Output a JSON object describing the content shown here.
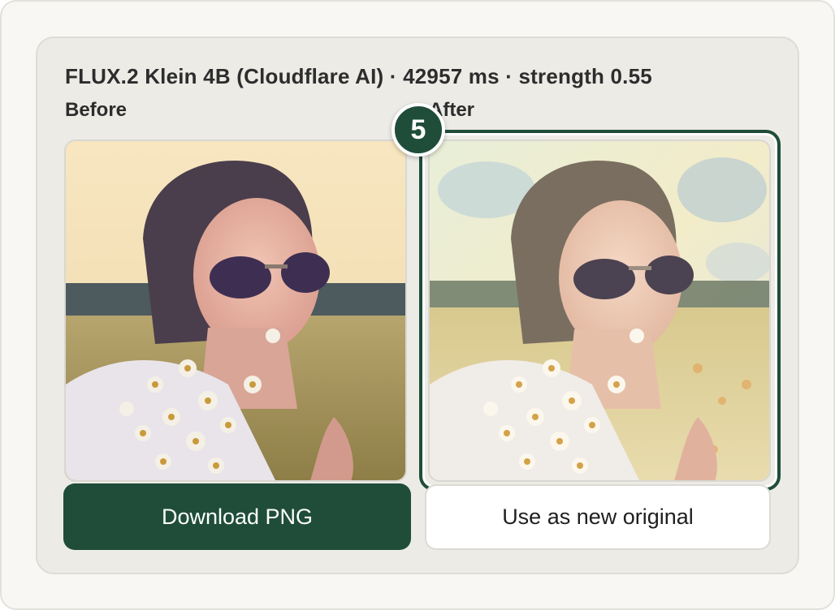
{
  "header": {
    "title": "FLUX.2 Klein 4B (Cloudflare AI) · 42957 ms · strength 0.55"
  },
  "panels": {
    "before_label": "Before",
    "after_label": "After"
  },
  "step_badge": "5",
  "actions": {
    "download_label": "Download PNG",
    "use_label": "Use as new original"
  },
  "colors": {
    "accent": "#1f4d3a",
    "card_bg": "#ecebe6"
  }
}
